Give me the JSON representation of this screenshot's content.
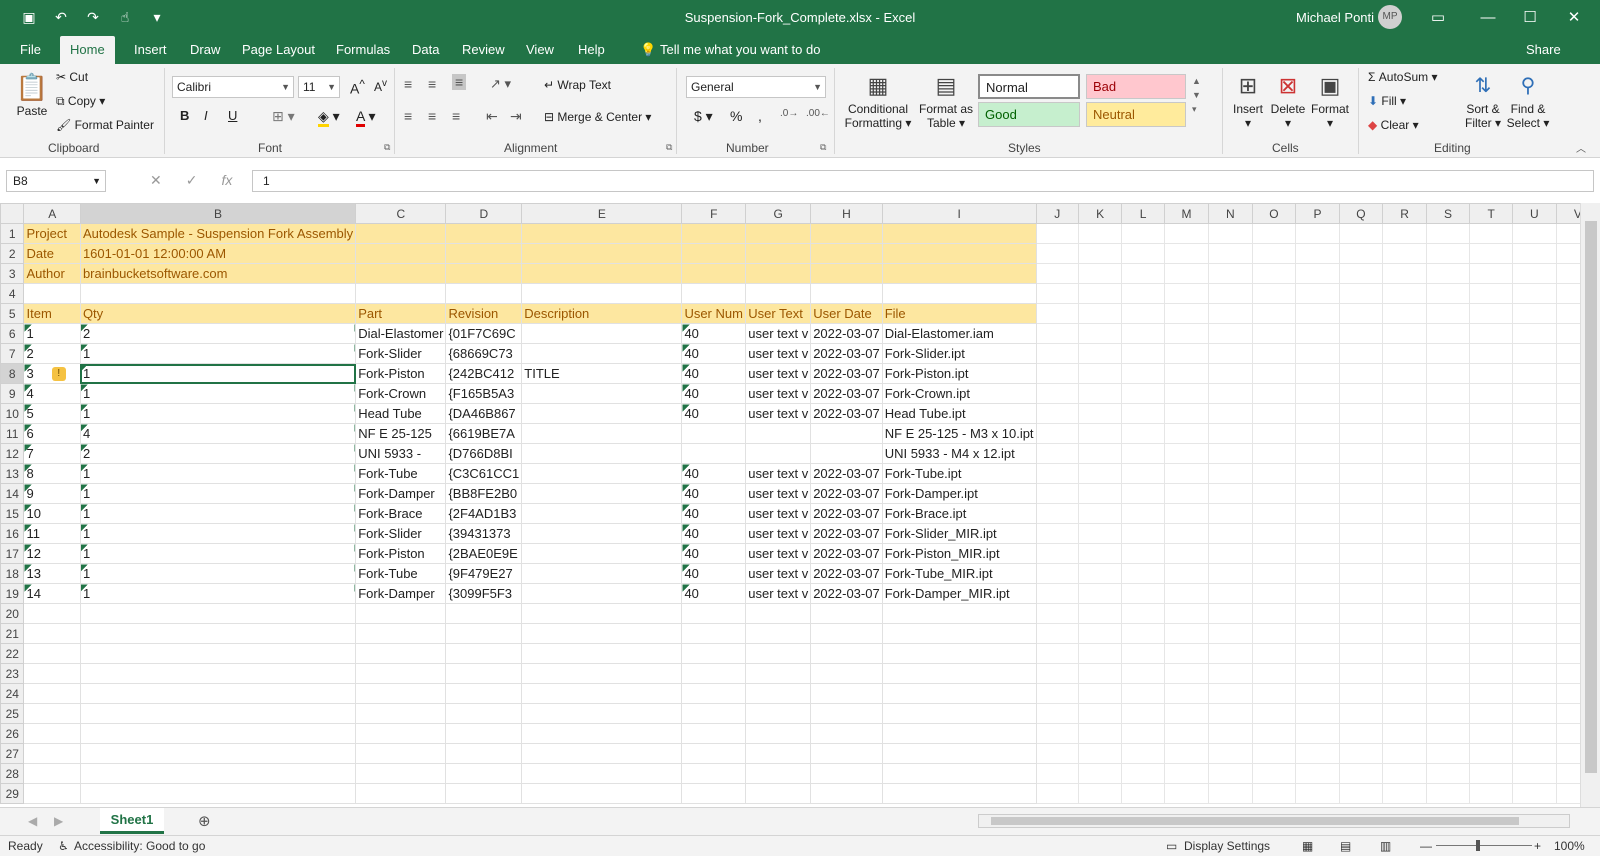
{
  "window": {
    "title": "Suspension-Fork_Complete.xlsx  -  Excel",
    "user_name": "Michael Ponti",
    "user_initials": "MP"
  },
  "qat": {
    "icons": [
      "save-icon",
      "undo-icon",
      "redo-icon",
      "touch-mode-icon",
      "customize-icon"
    ]
  },
  "tabs": [
    "File",
    "Home",
    "Insert",
    "Draw",
    "Page Layout",
    "Formulas",
    "Data",
    "Review",
    "View",
    "Help"
  ],
  "tell_me": "Tell me what you want to do",
  "share": "Share",
  "ribbon": {
    "clipboard": {
      "paste": "Paste",
      "cut": "Cut",
      "copy": "Copy",
      "format_painter": "Format Painter",
      "label": "Clipboard"
    },
    "font": {
      "name": "Calibri",
      "size": "11",
      "bold": "B",
      "italic": "I",
      "underline": "U",
      "label": "Font"
    },
    "alignment": {
      "wrap": "Wrap Text",
      "merge": "Merge & Center",
      "label": "Alignment"
    },
    "number": {
      "format": "General",
      "currency": "$",
      "percent": "%",
      "comma": ",",
      "label": "Number"
    },
    "styles": {
      "conditional_1": "Conditional",
      "conditional_2": "Formatting",
      "table_1": "Format as",
      "table_2": "Table",
      "normal": "Normal",
      "bad": "Bad",
      "good": "Good",
      "neutral": "Neutral",
      "label": "Styles"
    },
    "cells": {
      "insert": "Insert",
      "delete": "Delete",
      "format": "Format",
      "label": "Cells"
    },
    "editing": {
      "autosum": "AutoSum",
      "fill": "Fill",
      "clear": "Clear",
      "sort_1": "Sort &",
      "sort_2": "Filter",
      "find_1": "Find &",
      "find_2": "Select",
      "label": "Editing"
    }
  },
  "formula_bar": {
    "name_box": "B8",
    "value": "1",
    "fx": "fx"
  },
  "columns": [
    "A",
    "B",
    "C",
    "D",
    "E",
    "F",
    "G",
    "H",
    "I",
    "J",
    "K",
    "L",
    "M",
    "N",
    "O",
    "P",
    "Q",
    "R",
    "S",
    "T",
    "U",
    "V"
  ],
  "rows": [
    [
      "Project",
      "Autodesk Sample - Suspension Fork Assembly",
      "",
      "",
      "",
      "",
      "",
      "",
      ""
    ],
    [
      "Date",
      "1601-01-01 12:00:00 AM",
      "",
      "",
      "",
      "",
      "",
      "",
      ""
    ],
    [
      "Author",
      "brainbucketsoftware.com",
      "",
      "",
      "",
      "",
      "",
      "",
      ""
    ],
    [
      "",
      "",
      "",
      "",
      "",
      "",
      "",
      "",
      ""
    ],
    [
      "Item",
      "Qty",
      "Part",
      "Revision",
      "Description",
      "User Num",
      "User Text",
      "User Date",
      "File"
    ],
    [
      "1",
      "2",
      "Dial-Elastomer",
      "{01F7C69C",
      "",
      "40",
      "user text v",
      "2022-03-07",
      "Dial-Elastomer.iam"
    ],
    [
      "2",
      "1",
      "Fork-Slider",
      "{68669C73",
      "",
      "40",
      "user text v",
      "2022-03-07",
      "Fork-Slider.ipt"
    ],
    [
      "3",
      "1",
      "Fork-Piston",
      "{242BC412",
      "TITLE",
      "40",
      "user text v",
      "2022-03-07",
      "Fork-Piston.ipt"
    ],
    [
      "4",
      "1",
      "Fork-Crown",
      "{F165B5A3",
      "",
      "40",
      "user text v",
      "2022-03-07",
      "Fork-Crown.ipt"
    ],
    [
      "5",
      "1",
      "Head Tube",
      "{DA46B867",
      "",
      "40",
      "user text v",
      "2022-03-07",
      "Head Tube.ipt"
    ],
    [
      "6",
      "4",
      "NF E 25-125",
      "{6619BE7A",
      "",
      "",
      "",
      "",
      "NF E 25-125 - M3 x 10.ipt"
    ],
    [
      "7",
      "2",
      "UNI 5933 -",
      "{D766D8BI",
      "",
      "",
      "",
      "",
      "UNI 5933 - M4 x 12.ipt"
    ],
    [
      "8",
      "1",
      "Fork-Tube",
      "{C3C61CC1",
      "",
      "40",
      "user text v",
      "2022-03-07",
      "Fork-Tube.ipt"
    ],
    [
      "9",
      "1",
      "Fork-Damper",
      "{BB8FE2B0",
      "",
      "40",
      "user text v",
      "2022-03-07",
      "Fork-Damper.ipt"
    ],
    [
      "10",
      "1",
      "Fork-Brace",
      "{2F4AD1B3",
      "",
      "40",
      "user text v",
      "2022-03-07",
      "Fork-Brace.ipt"
    ],
    [
      "11",
      "1",
      "Fork-Slider",
      "{39431373",
      "",
      "40",
      "user text v",
      "2022-03-07",
      "Fork-Slider_MIR.ipt"
    ],
    [
      "12",
      "1",
      "Fork-Piston",
      "{2BAE0E9E",
      "",
      "40",
      "user text v",
      "2022-03-07",
      "Fork-Piston_MIR.ipt"
    ],
    [
      "13",
      "1",
      "Fork-Tube",
      "{9F479E27",
      "",
      "40",
      "user text v",
      "2022-03-07",
      "Fork-Tube_MIR.ipt"
    ],
    [
      "14",
      "1",
      "Fork-Damper",
      "{3099F5F3",
      "",
      "40",
      "user text v",
      "2022-03-07",
      "Fork-Damper_MIR.ipt"
    ],
    [
      "",
      "",
      "",
      "",
      "",
      "",
      "",
      "",
      ""
    ],
    [
      "",
      "",
      "",
      "",
      "",
      "",
      "",
      "",
      ""
    ],
    [
      "",
      "",
      "",
      "",
      "",
      "",
      "",
      "",
      ""
    ],
    [
      "",
      "",
      "",
      "",
      "",
      "",
      "",
      "",
      ""
    ],
    [
      "",
      "",
      "",
      "",
      "",
      "",
      "",
      "",
      ""
    ],
    [
      "",
      "",
      "",
      "",
      "",
      "",
      "",
      "",
      ""
    ],
    [
      "",
      "",
      "",
      "",
      "",
      "",
      "",
      "",
      ""
    ],
    [
      "",
      "",
      "",
      "",
      "",
      "",
      "",
      "",
      ""
    ],
    [
      "",
      "",
      "",
      "",
      "",
      "",
      "",
      "",
      ""
    ],
    [
      "",
      "",
      "",
      "",
      "",
      "",
      "",
      "",
      ""
    ]
  ],
  "sheet_tab": "Sheet1",
  "status": {
    "ready": "Ready",
    "accessibility": "Accessibility: Good to go",
    "display": "Display Settings",
    "zoom": "100%"
  },
  "colors": {
    "excel_green": "#217346",
    "highlight_fill": "#fde7a0",
    "highlight_text": "#9c5700"
  }
}
